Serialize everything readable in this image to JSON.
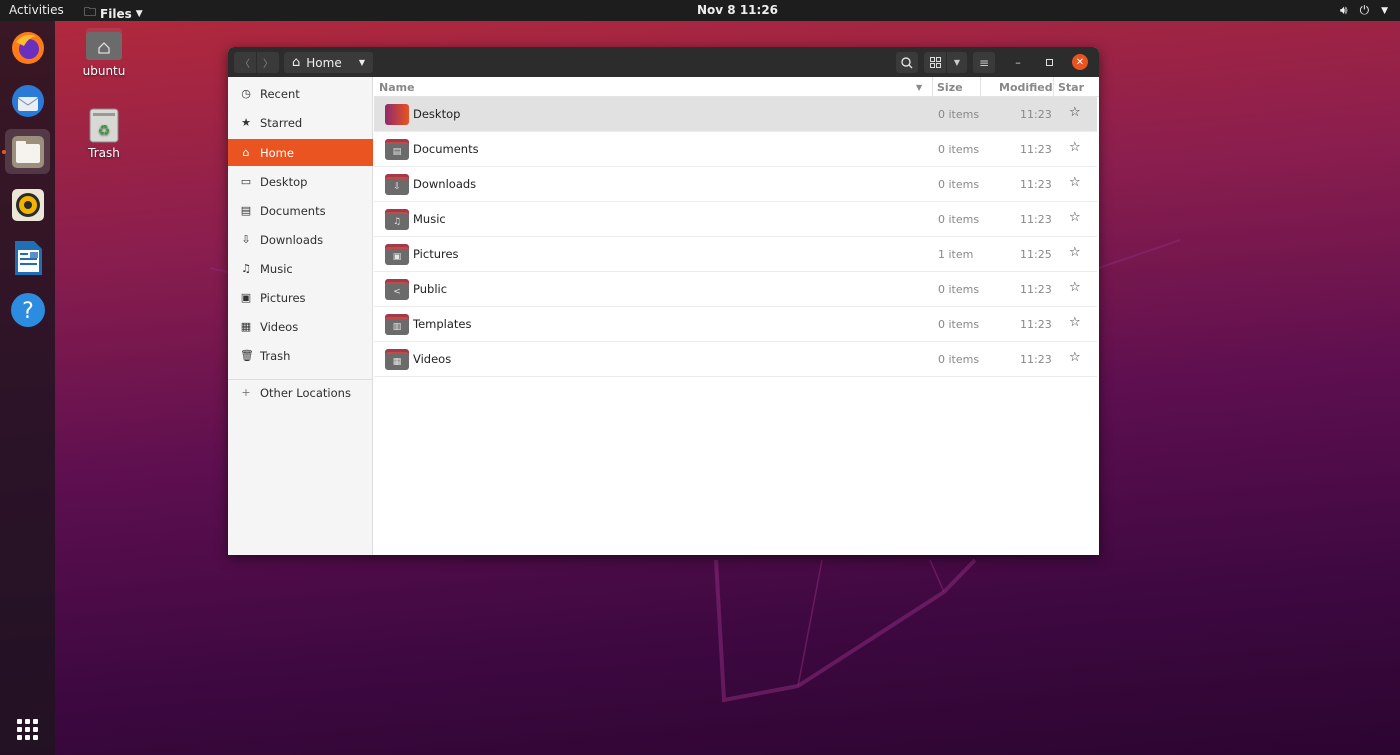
{
  "topbar": {
    "activities_label": "Activities",
    "app_menu_label": "Files",
    "clock": "Nov 8  11:26",
    "tray_icons": [
      "volume-icon",
      "power-icon",
      "chevron-down-icon"
    ]
  },
  "dock": {
    "apps": [
      {
        "name": "Firefox",
        "icon": "firefox-icon"
      },
      {
        "name": "Thunderbird",
        "icon": "thunderbird-icon"
      },
      {
        "name": "Files",
        "icon": "files-icon",
        "active": true
      },
      {
        "name": "Rhythmbox",
        "icon": "rhythmbox-icon"
      },
      {
        "name": "LibreOffice Writer",
        "icon": "writer-icon"
      },
      {
        "name": "Help",
        "icon": "help-icon",
        "glyph": "?"
      }
    ],
    "show_apps_icon": "app-grid-icon"
  },
  "desktop": {
    "icons": [
      {
        "label": "ubuntu",
        "icon": "home-folder-icon"
      },
      {
        "label": "Trash",
        "icon": "trash-icon"
      }
    ]
  },
  "window": {
    "path_label": "Home",
    "nav_back_glyph": "〈",
    "nav_forward_glyph": "〉",
    "colors": {
      "accent": "#e95420",
      "headerbar": "#2c2c2c"
    }
  },
  "sidebar": {
    "items": [
      {
        "label": "Recent",
        "icon": "clock-icon",
        "glyph": "◷"
      },
      {
        "label": "Starred",
        "icon": "star-icon",
        "glyph": "★"
      },
      {
        "label": "Home",
        "icon": "home-icon",
        "glyph": "⌂",
        "active": true
      },
      {
        "label": "Desktop",
        "icon": "desktop-icon",
        "glyph": "▭"
      },
      {
        "label": "Documents",
        "icon": "document-icon",
        "glyph": "▤"
      },
      {
        "label": "Downloads",
        "icon": "download-icon",
        "glyph": "⇩"
      },
      {
        "label": "Music",
        "icon": "music-icon",
        "glyph": "♫"
      },
      {
        "label": "Pictures",
        "icon": "picture-icon",
        "glyph": "▣"
      },
      {
        "label": "Videos",
        "icon": "video-icon",
        "glyph": "▦"
      },
      {
        "label": "Trash",
        "icon": "trash-icon",
        "glyph": "🗑"
      }
    ],
    "other_locations": {
      "label": "Other Locations",
      "glyph": "+"
    }
  },
  "file_list": {
    "columns": {
      "name": "Name",
      "size": "Size",
      "modified": "Modified",
      "star": "Star"
    },
    "rows": [
      {
        "name": "Desktop",
        "size": "0 items",
        "modified": "11:23",
        "glyph": "",
        "selected": true
      },
      {
        "name": "Documents",
        "size": "0 items",
        "modified": "11:23",
        "glyph": "▤"
      },
      {
        "name": "Downloads",
        "size": "0 items",
        "modified": "11:23",
        "glyph": "⇩"
      },
      {
        "name": "Music",
        "size": "0 items",
        "modified": "11:23",
        "glyph": "♫"
      },
      {
        "name": "Pictures",
        "size": "1 item",
        "modified": "11:25",
        "glyph": "▣"
      },
      {
        "name": "Public",
        "size": "0 items",
        "modified": "11:23",
        "glyph": "<"
      },
      {
        "name": "Templates",
        "size": "0 items",
        "modified": "11:23",
        "glyph": "▥"
      },
      {
        "name": "Videos",
        "size": "0 items",
        "modified": "11:23",
        "glyph": "▦"
      }
    ],
    "star_glyph": "☆"
  }
}
